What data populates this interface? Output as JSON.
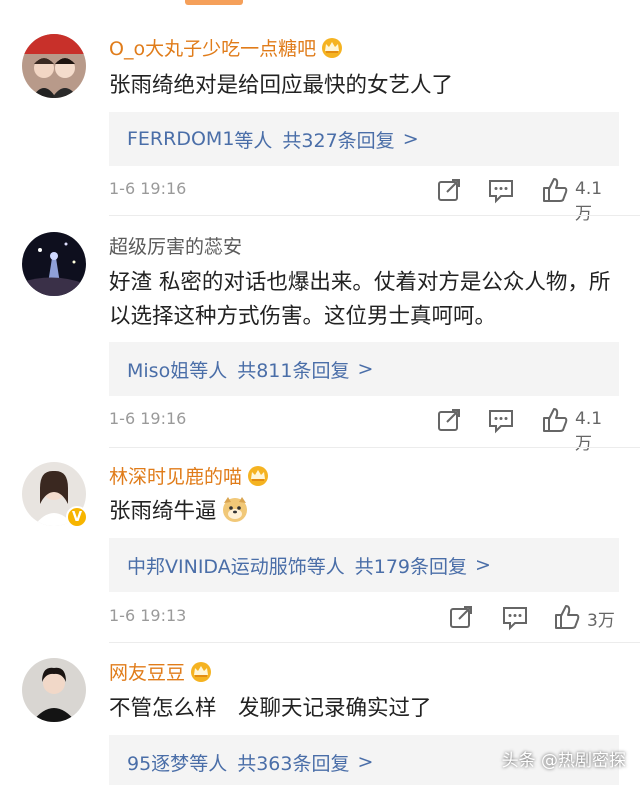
{
  "comments": [
    {
      "username": "O_o大丸子少吃一点糖吧",
      "text": "张雨绮绝对是给回应最快的女艺人了",
      "reply_names": "FERRDOM1",
      "reply_suffix": "等人",
      "reply_count": "共327条回复",
      "time": "1-6 19:16",
      "likes": "4.1万"
    },
    {
      "username": "超级厉害的蕊安",
      "text": "好渣 私密的对话也爆出来。仗着对方是公众人物，所以选择这种方式伤害。这位男士真呵呵。",
      "reply_names": "Miso姐",
      "reply_suffix": "等人",
      "reply_count": "共811条回复",
      "time": "1-6 19:16",
      "likes": "4.1万"
    },
    {
      "username": "林深时见鹿的喵",
      "text": "张雨绮牛逼",
      "reply_names": "中邦VINIDA运动服饰",
      "reply_suffix": "等人",
      "reply_count": "共179条回复",
      "time": "1-6 19:13",
      "likes": "3万"
    },
    {
      "username": "网友豆豆",
      "text": "不管怎么样　发聊天记录确实过了",
      "reply_names": "95逐梦",
      "reply_suffix": "等人",
      "reply_count": "共363条回复",
      "time": "",
      "likes": ""
    }
  ],
  "reply_arrow": ">",
  "verified_mark": "V",
  "watermark": "头条 @热剧密探",
  "icons": [
    "share-icon",
    "comment-icon",
    "like-icon",
    "crown-badge-icon",
    "doge-emoji-icon"
  ],
  "colors": {
    "username_vip": "#e07c1a",
    "reply_link": "#4a6ea8",
    "time_gray": "#9a9a9a",
    "reply_bg": "#f4f4f4",
    "badge": "#f7b500"
  }
}
